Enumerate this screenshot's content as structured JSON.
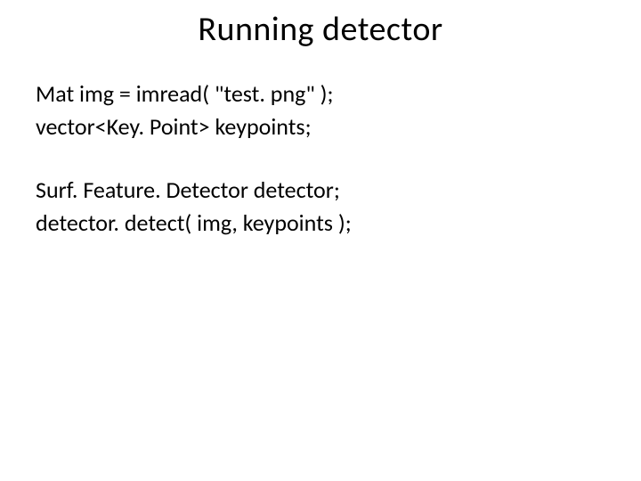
{
  "slide": {
    "title": "Running detector",
    "lines": {
      "l1": "Mat img = imread( \"test. png\" );",
      "l2": "vector<Key. Point> keypoints;",
      "l3": "Surf. Feature. Detector detector;",
      "l4": "detector. detect( img, keypoints );"
    }
  }
}
